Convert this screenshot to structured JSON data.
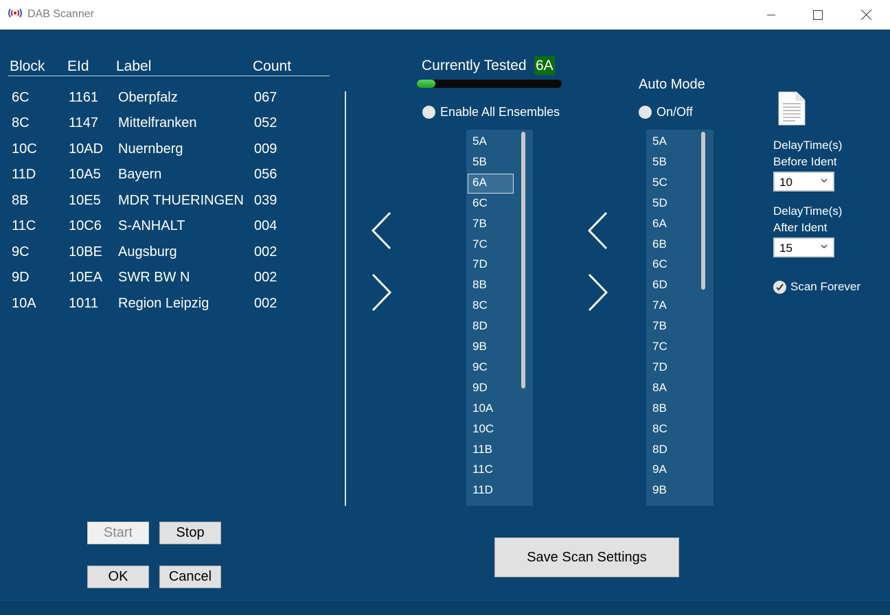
{
  "window": {
    "title": "DAB Scanner",
    "minimize_symbol": "—",
    "maximize_symbol": "☐",
    "close_symbol": "✕"
  },
  "colors": {
    "background": "#0b4470",
    "list_background": "#1e5883",
    "accent_green": "#0d6e0d",
    "progress_green": "#3cbf3c"
  },
  "table": {
    "headers": [
      "Block",
      "EId",
      "Label",
      "Count"
    ],
    "rows": [
      [
        "6C",
        "1161",
        "Oberpfalz",
        "067"
      ],
      [
        "8C",
        "1147",
        "Mittelfranken",
        "052"
      ],
      [
        "10C",
        "10AD",
        "Nuernberg",
        "009"
      ],
      [
        "11D",
        "10A5",
        "Bayern",
        "056"
      ],
      [
        "8B",
        "10E5",
        "MDR THUERINGEN",
        "039"
      ],
      [
        "11C",
        "10C6",
        "S-ANHALT",
        "004"
      ],
      [
        "9C",
        "10BE",
        "Augsburg",
        "002"
      ],
      [
        "9D",
        "10EA",
        "SWR BW N",
        "002"
      ],
      [
        "10A",
        "1011",
        "Region Leipzig",
        "002"
      ]
    ]
  },
  "buttons": {
    "start": "Start",
    "stop": "Stop",
    "ok": "OK",
    "cancel": "Cancel",
    "save": "Save Scan Settings"
  },
  "scan": {
    "currently_tested_label": "Currently Tested",
    "currently_tested_value": "6A",
    "progress_fraction": 0.13,
    "enable_all_label": "Enable All Ensembles",
    "auto_mode_label": "Auto Mode",
    "on_off_label": "On/Off"
  },
  "left_list": {
    "items": [
      "5A",
      "5B",
      "6A",
      "6C",
      "7B",
      "7C",
      "7D",
      "8B",
      "8C",
      "8D",
      "9B",
      "9C",
      "9D",
      "10A",
      "10C",
      "11B",
      "11C",
      "11D"
    ],
    "selected_index": 2
  },
  "right_list": {
    "items": [
      "5A",
      "5B",
      "5C",
      "5D",
      "6A",
      "6B",
      "6C",
      "6D",
      "7A",
      "7B",
      "7C",
      "7D",
      "8A",
      "8B",
      "8C",
      "8D",
      "9A",
      "9B"
    ]
  },
  "settings": {
    "delay_before_line1": "DelayTime(s)",
    "delay_before_line2": "Before Ident",
    "delay_before_value": "10",
    "delay_after_line1": "DelayTime(s)",
    "delay_after_line2": "After Ident",
    "delay_after_value": "15",
    "scan_forever_label": "Scan Forever",
    "scan_forever_checked": true,
    "dropdown_arrow": "⌄"
  },
  "icons": {
    "app": "radio-signal-icon",
    "document": "document-icon",
    "arrow_left": "chevron-left-icon",
    "arrow_right": "chevron-right-icon",
    "check": "check-icon"
  }
}
